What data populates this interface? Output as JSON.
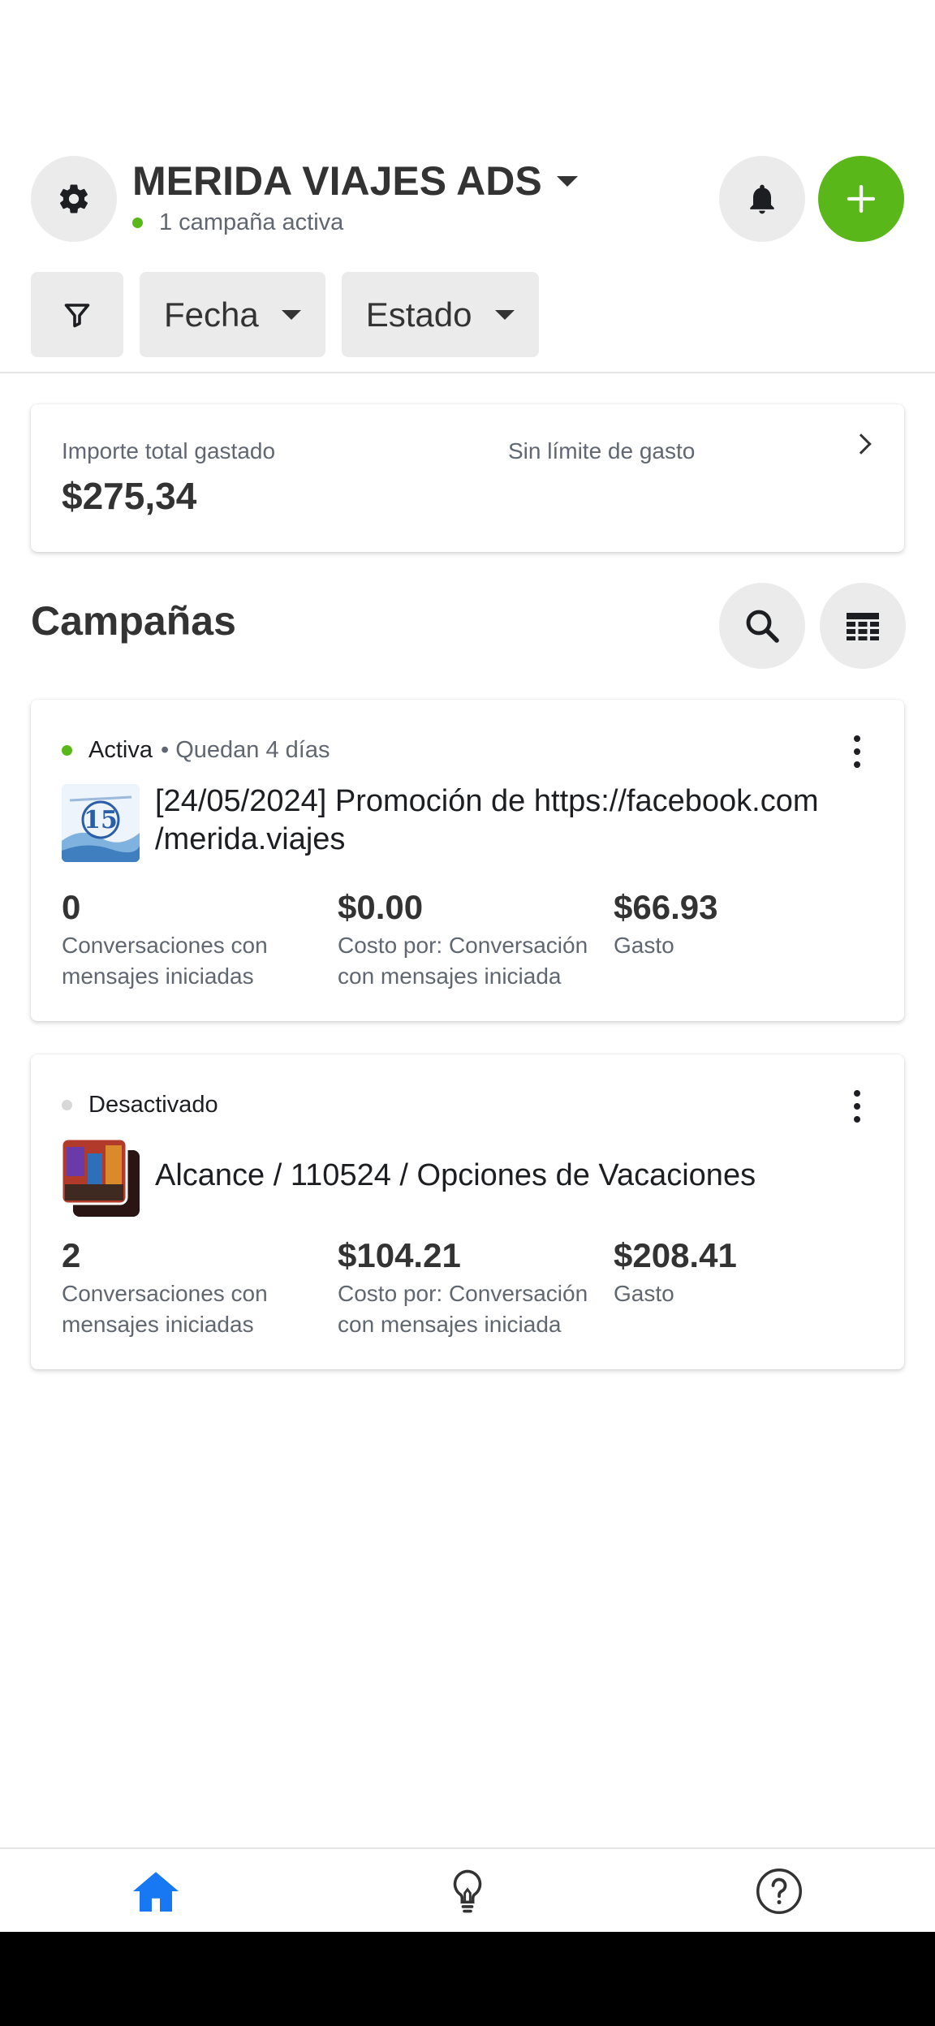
{
  "header": {
    "account_name": "MERIDA VIAJES ADS",
    "active_campaigns": "1 campaña activa"
  },
  "filters": {
    "date": "Fecha",
    "status": "Estado"
  },
  "spend_card": {
    "label": "Importe total gastado",
    "amount": "$275,34",
    "limit": "Sin límite de gasto"
  },
  "campaigns": {
    "title": "Campañas",
    "items": [
      {
        "status": "Activa",
        "extra": "• Quedan 4 días",
        "title": "[24/05/2024] Promoción de https://facebook.com /merida.viajes",
        "metrics": [
          {
            "value": "0",
            "label": "Conversaciones con mensajes iniciadas"
          },
          {
            "value": "$0.00",
            "label": "Costo por: Conversación con mensajes iniciada"
          },
          {
            "value": "$66.93",
            "label": "Gasto"
          }
        ]
      },
      {
        "status": "Desactivado",
        "extra": "",
        "title": "Alcance / 110524 / Opciones de Vacaciones",
        "metrics": [
          {
            "value": "2",
            "label": "Conversaciones con mensajes iniciadas"
          },
          {
            "value": "$104.21",
            "label": "Costo por: Conversación con mensajes iniciada"
          },
          {
            "value": "$208.41",
            "label": "Gasto"
          }
        ]
      }
    ]
  },
  "colors": {
    "accent_green": "#5ab71a",
    "nav_active_blue": "#1877f2",
    "chip_grey": "#ebebeb"
  },
  "icons": [
    "gear-icon",
    "bell-icon",
    "plus-icon",
    "filter-icon",
    "search-icon",
    "table-icon",
    "more-vertical-icon",
    "home-icon",
    "lightbulb-icon",
    "help-icon"
  ]
}
